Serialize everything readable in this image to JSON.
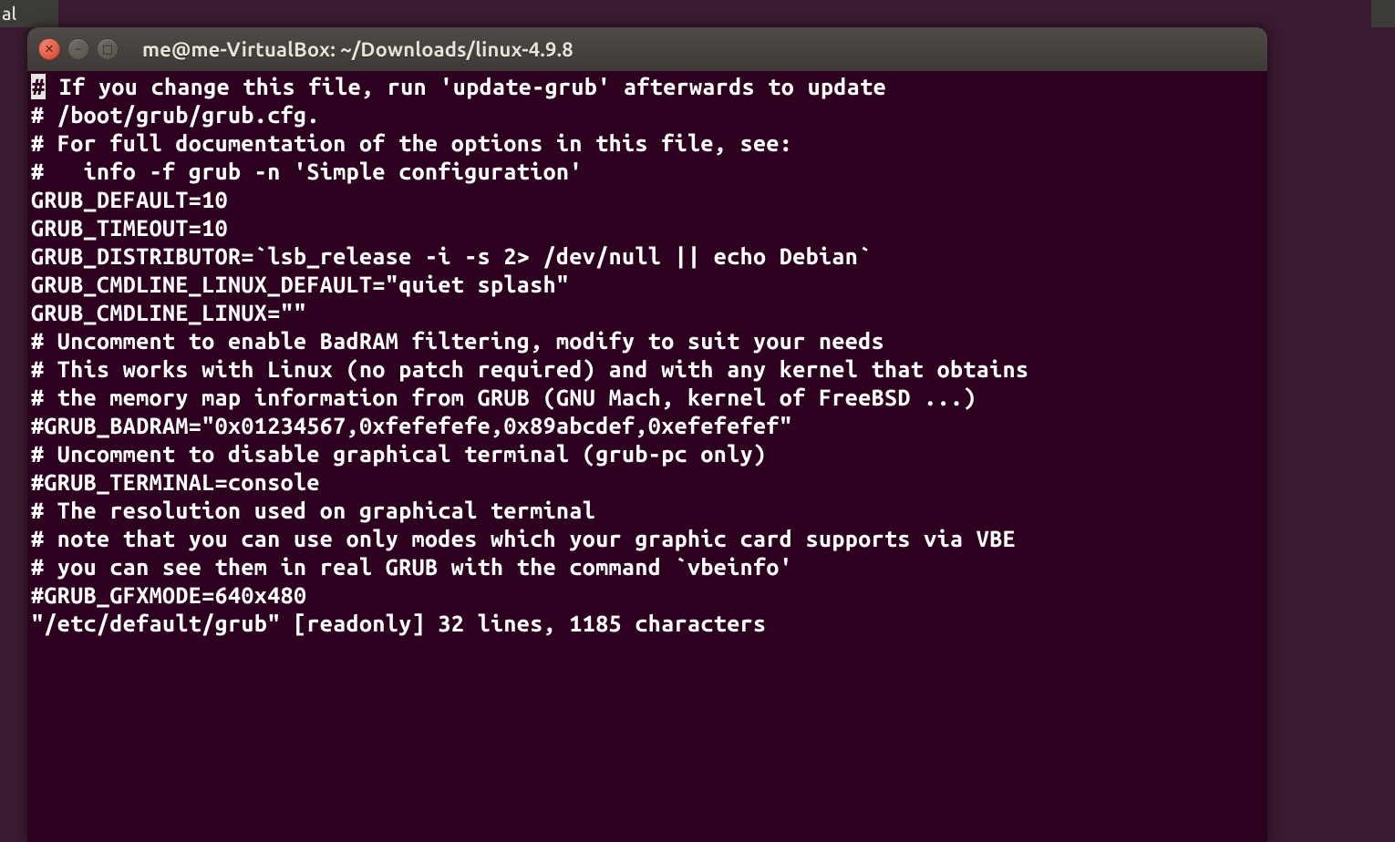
{
  "partial_tab_text": "al",
  "window": {
    "title": "me@me-VirtualBox: ~/Downloads/linux-4.9.8"
  },
  "cursor_char": "#",
  "terminal_lines": [
    " If you change this file, run 'update-grub' afterwards to update",
    "# /boot/grub/grub.cfg.",
    "# For full documentation of the options in this file, see:",
    "#   info -f grub -n 'Simple configuration'",
    "",
    "GRUB_DEFAULT=10",
    "GRUB_TIMEOUT=10",
    "GRUB_DISTRIBUTOR=`lsb_release -i -s 2> /dev/null || echo Debian`",
    "GRUB_CMDLINE_LINUX_DEFAULT=\"quiet splash\"",
    "GRUB_CMDLINE_LINUX=\"\"",
    "",
    "# Uncomment to enable BadRAM filtering, modify to suit your needs",
    "# This works with Linux (no patch required) and with any kernel that obtains",
    "# the memory map information from GRUB (GNU Mach, kernel of FreeBSD ...)",
    "#GRUB_BADRAM=\"0x01234567,0xfefefefe,0x89abcdef,0xefefefef\"",
    "",
    "# Uncomment to disable graphical terminal (grub-pc only)",
    "#GRUB_TERMINAL=console",
    "",
    "# The resolution used on graphical terminal",
    "# note that you can use only modes which your graphic card supports via VBE",
    "# you can see them in real GRUB with the command `vbeinfo'",
    "#GRUB_GFXMODE=640x480",
    "\"/etc/default/grub\" [readonly] 32 lines, 1185 characters"
  ]
}
